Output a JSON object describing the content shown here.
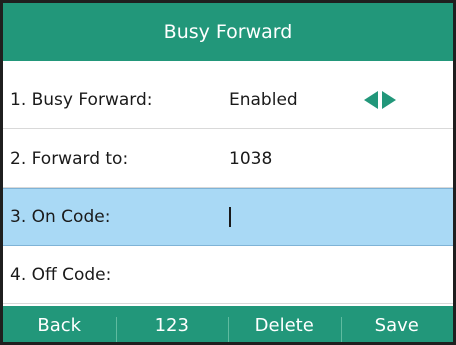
{
  "screen": {
    "title": "Busy Forward"
  },
  "rows": [
    {
      "label": "1. Busy Forward:",
      "value": "Enabled"
    },
    {
      "label": "2. Forward to:",
      "value": "1038"
    },
    {
      "label": "3. On Code:",
      "value": ""
    },
    {
      "label": "4. Off Code:",
      "value": ""
    }
  ],
  "icons": {
    "left": "arrow-left-icon",
    "right": "arrow-right-icon",
    "accent_color": "#22977a",
    "selection_color": "#a9d9f5"
  },
  "softkeys": [
    {
      "label": "Back"
    },
    {
      "label": "123"
    },
    {
      "label": "Delete"
    },
    {
      "label": "Save"
    }
  ]
}
